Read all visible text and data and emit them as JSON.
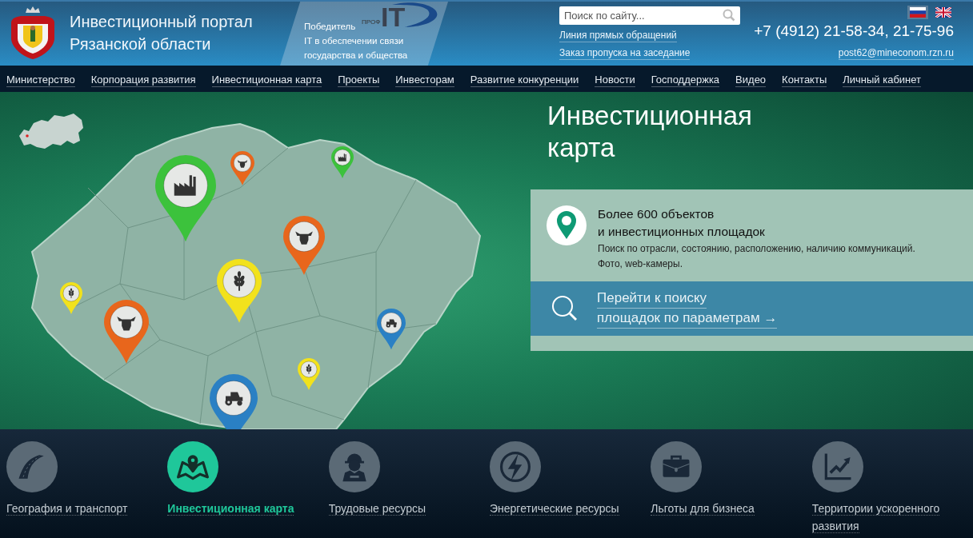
{
  "header": {
    "title": "Инвестиционный портал Рязанской области",
    "award": {
      "logo_small": "ПРОФ",
      "logo_big": "IT",
      "label": "Победитель",
      "text": "IT в обеспечении связи государства и общества"
    },
    "search": {
      "placeholder": "Поиск по сайту..."
    },
    "links": [
      "Линия прямых обращений",
      "Заказ пропуска на заседание"
    ],
    "languages": [
      {
        "kind": "ru",
        "selected": true
      },
      {
        "kind": "en",
        "selected": false
      }
    ],
    "phone": "+7 (4912) 21-58-34, 21-75-96",
    "email": "post62@mineconom.rzn.ru"
  },
  "nav": [
    "Министерство",
    "Корпорация развития",
    "Инвестиционная карта",
    "Проекты",
    "Инвесторам",
    "Развитие конкуренции",
    "Новости",
    "Господдержка",
    "Видео",
    "Контакты",
    "Личный кабинет"
  ],
  "hero": {
    "title": "Инвестиционная карта",
    "pins": [
      {
        "kind": "factory",
        "color": "#3cc23c"
      },
      {
        "kind": "cow",
        "color": "#e8661c"
      },
      {
        "kind": "factory",
        "color": "#3cc23c"
      },
      {
        "kind": "cow",
        "color": "#e8661c"
      },
      {
        "kind": "wheat",
        "color": "#f2e21c"
      },
      {
        "kind": "wheat",
        "color": "#f2e21c"
      },
      {
        "kind": "cow",
        "color": "#e8661c"
      },
      {
        "kind": "tractor",
        "color": "#2a80c4"
      },
      {
        "kind": "wheat",
        "color": "#f2e21c"
      },
      {
        "kind": "tractor",
        "color": "#2a80c4"
      }
    ],
    "info": {
      "heading": [
        "Более 600 объектов",
        "и инвестиционных площадок"
      ],
      "description": [
        "Поиск по отрасли, состоянию, расположению, наличию коммуникаций.",
        "Фото, web-камеры."
      ],
      "link": [
        "Перейти к поиску",
        "площадок по параметрам →"
      ]
    }
  },
  "categories": [
    {
      "kind": "road",
      "label": "География и транспорт",
      "selected": false
    },
    {
      "kind": "map",
      "label": "Инвестиционная карта",
      "selected": true
    },
    {
      "kind": "worker",
      "label": "Трудовые ресурсы",
      "selected": false
    },
    {
      "kind": "energy",
      "label": "Энергетические ресурсы",
      "selected": false
    },
    {
      "kind": "briefcase",
      "label": "Льготы для бизнеса",
      "selected": false
    },
    {
      "kind": "chart",
      "label": "Территории ускоренного развития",
      "selected": false
    }
  ]
}
